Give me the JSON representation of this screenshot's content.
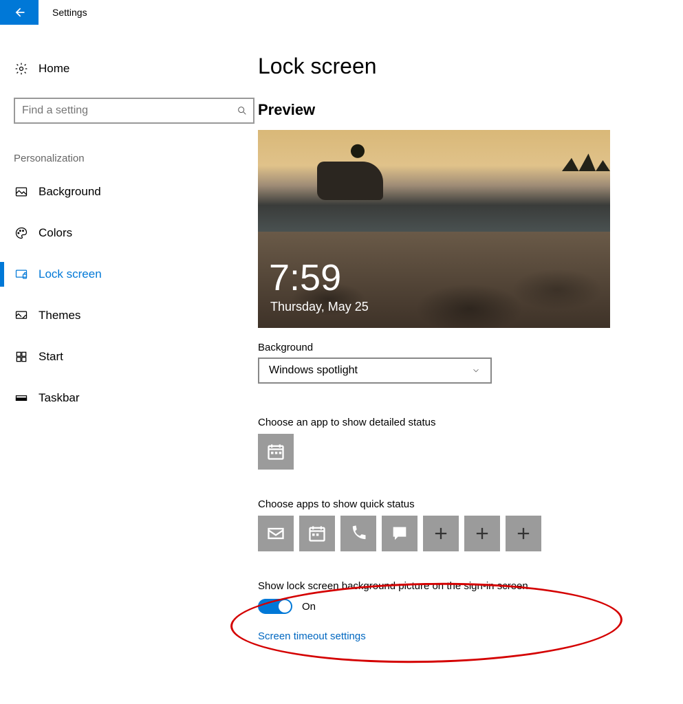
{
  "app_title": "Settings",
  "sidebar": {
    "home_label": "Home",
    "search_placeholder": "Find a setting",
    "section_header": "Personalization",
    "items": [
      {
        "label": "Background",
        "icon": "picture-icon"
      },
      {
        "label": "Colors",
        "icon": "palette-icon"
      },
      {
        "label": "Lock screen",
        "icon": "lock-screen-icon",
        "selected": true
      },
      {
        "label": "Themes",
        "icon": "themes-icon"
      },
      {
        "label": "Start",
        "icon": "start-icon"
      },
      {
        "label": "Taskbar",
        "icon": "taskbar-icon"
      }
    ]
  },
  "main": {
    "title": "Lock screen",
    "preview_header": "Preview",
    "preview": {
      "time": "7:59",
      "date": "Thursday, May 25"
    },
    "background_label": "Background",
    "background_value": "Windows spotlight",
    "detailed_status_label": "Choose an app to show detailed status",
    "quick_status_label": "Choose apps to show quick status",
    "toggle_label": "Show lock screen background picture on the sign-in screen",
    "toggle_state_text": "On",
    "link_screen_timeout": "Screen timeout settings"
  }
}
